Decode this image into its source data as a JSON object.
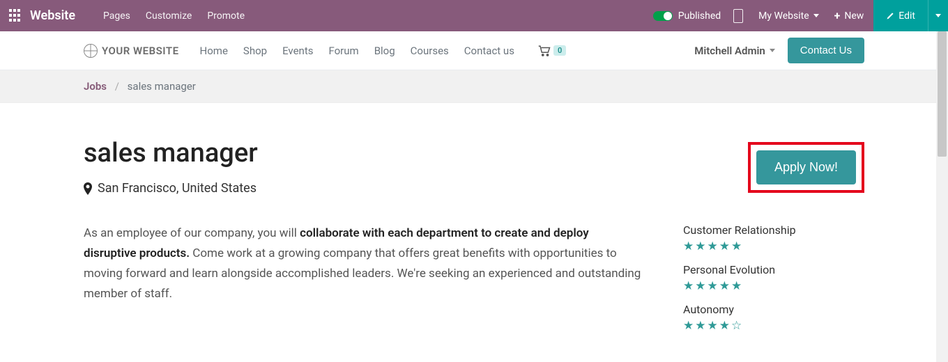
{
  "topbar": {
    "brand": "Website",
    "menu": [
      "Pages",
      "Customize",
      "Promote"
    ],
    "published": "Published",
    "my_website": "My Website",
    "new": "New",
    "edit": "Edit"
  },
  "sitebar": {
    "logo": "YOUR WEBSITE",
    "nav": [
      "Home",
      "Shop",
      "Events",
      "Forum",
      "Blog",
      "Courses",
      "Contact us"
    ],
    "cart_count": "0",
    "user": "Mitchell Admin",
    "contact": "Contact Us"
  },
  "breadcrumb": {
    "root": "Jobs",
    "current": "sales manager"
  },
  "job": {
    "title": "sales manager",
    "location": "San Francisco, United States",
    "apply": "Apply Now!",
    "desc_lead": "As an employee of our company, you will ",
    "desc_bold": "collaborate with each department to create and deploy disruptive products.",
    "desc_tail": " Come work at a growing company that offers great benefits with opportunities to moving forward and learn alongside accomplished leaders. We're seeking an experienced and outstanding member of staff."
  },
  "ratings": [
    {
      "label": "Customer Relationship",
      "stars": 5
    },
    {
      "label": "Personal Evolution",
      "stars": 5
    },
    {
      "label": "Autonomy",
      "stars": 4
    }
  ]
}
